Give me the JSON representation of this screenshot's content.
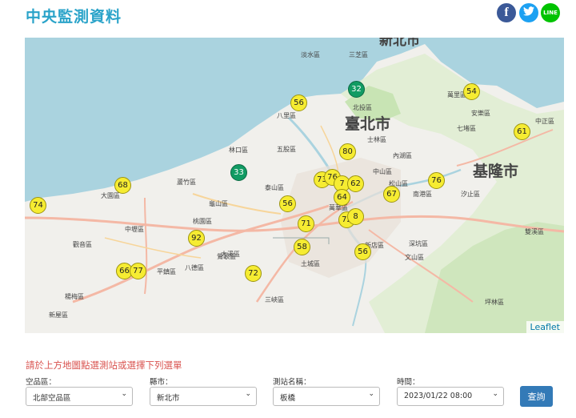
{
  "header": {
    "title": "中央監測資料"
  },
  "social": {
    "facebook": "f",
    "twitter": "t",
    "line": "LINE"
  },
  "map": {
    "attribution": "Leaflet",
    "city_labels": {
      "taipei": "臺北市",
      "newtaipei": "新北市",
      "keelung": "基隆市"
    },
    "districts": [
      "淡水區",
      "三芝區",
      "八里區",
      "北投區",
      "士林區",
      "五股區",
      "林口區",
      "蘆竹區",
      "桃園區",
      "龜山區",
      "中山區",
      "松山區",
      "內湖區",
      "南港區",
      "汐止區",
      "七堵區",
      "安樂區",
      "萬里區",
      "中正區",
      "土城區",
      "三峽區",
      "鶯歌區",
      "八德區",
      "新屋區",
      "楊梅區",
      "大園區",
      "觀音區",
      "深坑區",
      "文山區",
      "坪林區",
      "雙溪區",
      "萬華區",
      "泰山區",
      "新店區",
      "大溪區",
      "平鎮區",
      "中壢區"
    ],
    "markers": [
      {
        "value": "32",
        "level": "green"
      },
      {
        "value": "54",
        "level": "yellow"
      },
      {
        "value": "56",
        "level": "yellow"
      },
      {
        "value": "61",
        "level": "yellow"
      },
      {
        "value": "80",
        "level": "yellow"
      },
      {
        "value": "33",
        "level": "green"
      },
      {
        "value": "76",
        "level": "yellow"
      },
      {
        "value": "68",
        "level": "yellow"
      },
      {
        "value": "73",
        "level": "yellow"
      },
      {
        "value": "76",
        "level": "yellow"
      },
      {
        "value": "7",
        "level": "yellow"
      },
      {
        "value": "62",
        "level": "yellow"
      },
      {
        "value": "64",
        "level": "yellow"
      },
      {
        "value": "67",
        "level": "yellow"
      },
      {
        "value": "74",
        "level": "yellow"
      },
      {
        "value": "56",
        "level": "yellow"
      },
      {
        "value": "71",
        "level": "yellow"
      },
      {
        "value": "72",
        "level": "yellow"
      },
      {
        "value": "8",
        "level": "yellow"
      },
      {
        "value": "92",
        "level": "yellow"
      },
      {
        "value": "58",
        "level": "yellow"
      },
      {
        "value": "56",
        "level": "yellow"
      },
      {
        "value": "66",
        "level": "yellow"
      },
      {
        "value": "77",
        "level": "yellow"
      },
      {
        "value": "72",
        "level": "yellow"
      }
    ]
  },
  "form": {
    "hint": "請於上方地圖點選測站或選擇下列選單",
    "air_zone": {
      "label": "空品區：",
      "value": "北部空品區"
    },
    "county": {
      "label": "縣市：",
      "value": "新北市"
    },
    "station": {
      "label": "測站名稱：",
      "value": "板橋"
    },
    "time": {
      "label": "時間：",
      "value": "2023/01/22 08:00"
    },
    "submit_label": "查詢"
  },
  "colors": {
    "title": "#2aa3c9",
    "good": "#119b63",
    "moderate": "#f6ec32",
    "hint": "#d9534f",
    "button": "#337ab7"
  }
}
